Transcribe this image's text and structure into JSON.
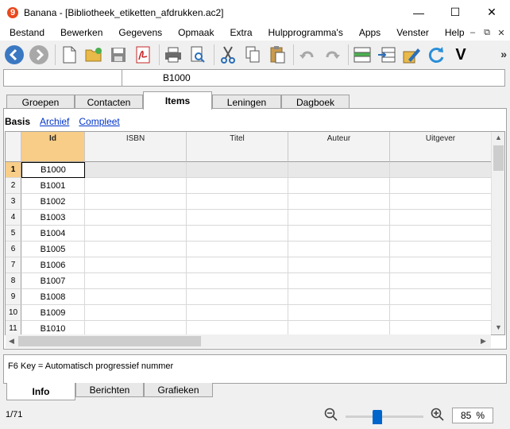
{
  "window": {
    "app_name": "Banana",
    "title": "Banana - [Bibliotheek_etiketten_afdrukken.ac2]",
    "logo_char": "9"
  },
  "window_controls": {
    "minimize": "—",
    "maximize": "☐",
    "close": "✕"
  },
  "menubar": {
    "items": [
      "Bestand",
      "Bewerken",
      "Gegevens",
      "Opmaak",
      "Extra",
      "Hulpprogramma's",
      "Apps",
      "Venster",
      "Help"
    ],
    "doc_controls": [
      "–",
      "⧉",
      "✕"
    ]
  },
  "toolbar": {
    "buttons": [
      "back-icon",
      "forward-icon",
      "new-document-icon",
      "open-folder-icon",
      "save-icon",
      "pdf-icon",
      "print-icon",
      "print-preview-icon",
      "cut-icon",
      "copy-icon",
      "paste-icon",
      "undo-icon",
      "redo-icon",
      "insert-row-icon",
      "move-rows-icon",
      "edit-tools-icon",
      "recalculate-icon",
      "check-icon"
    ],
    "more_label": "»",
    "check_label": "V"
  },
  "cellbar": {
    "address": "",
    "content": "B1000"
  },
  "table_tabs": [
    {
      "label": "Groepen",
      "active": false
    },
    {
      "label": "Contacten",
      "active": false
    },
    {
      "label": "Items",
      "active": true
    },
    {
      "label": "Leningen",
      "active": false
    },
    {
      "label": "Dagboek",
      "active": false
    }
  ],
  "views": [
    {
      "label": "Basis",
      "active": true
    },
    {
      "label": "Archief",
      "active": false
    },
    {
      "label": "Compleet",
      "active": false
    }
  ],
  "grid": {
    "columns": [
      "Id",
      "ISBN",
      "Titel",
      "Auteur",
      "Uitgever"
    ],
    "selected_column": "Id",
    "rows": [
      {
        "num": "1",
        "id": "B1000"
      },
      {
        "num": "2",
        "id": "B1001"
      },
      {
        "num": "3",
        "id": "B1002"
      },
      {
        "num": "4",
        "id": "B1003"
      },
      {
        "num": "5",
        "id": "B1004"
      },
      {
        "num": "6",
        "id": "B1005"
      },
      {
        "num": "7",
        "id": "B1006"
      },
      {
        "num": "8",
        "id": "B1007"
      },
      {
        "num": "9",
        "id": "B1008"
      },
      {
        "num": "10",
        "id": "B1009"
      },
      {
        "num": "11",
        "id": "B1010"
      }
    ],
    "selected_row": "1"
  },
  "info": {
    "text": "F6 Key = Automatisch progressief nummer"
  },
  "bottom_tabs": [
    {
      "label": "Info",
      "active": true
    },
    {
      "label": "Berichten",
      "active": false
    },
    {
      "label": "Grafieken",
      "active": false
    }
  ],
  "status": {
    "record_count": "1/71",
    "zoom_value": "85",
    "zoom_unit": "%"
  },
  "colors": {
    "selected_header": "#f7cd87",
    "link": "#0033cc",
    "slider_thumb": "#0066cc"
  }
}
